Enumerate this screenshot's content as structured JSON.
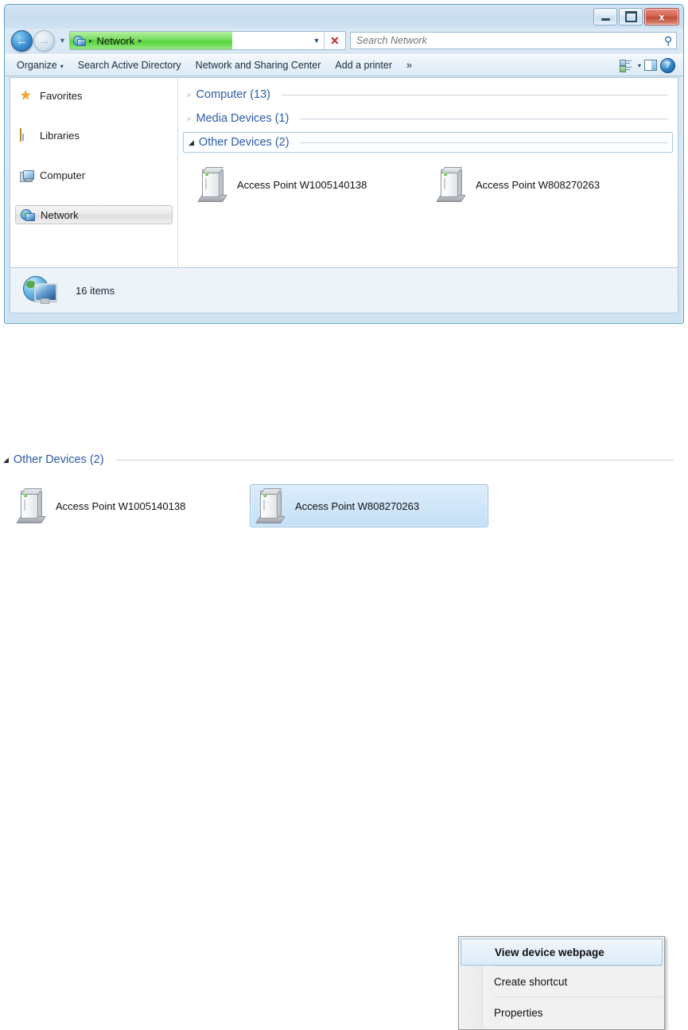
{
  "window": {
    "controls": {
      "minimize": "minimize-button",
      "maximize": "maximize-button",
      "close_label": "x"
    },
    "address": {
      "root_icon": "network-globe-icon",
      "crumb": "Network",
      "separator": "▸",
      "progress_percent": 59,
      "dropdown_glyph": "▼",
      "stop_glyph": "✕"
    },
    "search": {
      "placeholder": "Search Network",
      "value": "",
      "icon": "search-icon"
    },
    "toolbar": {
      "organize": "Organize",
      "organize_caret": "▾",
      "search_active_directory": "Search Active Directory",
      "network_sharing_center": "Network and Sharing Center",
      "add_a_printer": "Add a printer",
      "overflow": "»",
      "views_caret": "▾",
      "help_glyph": "?"
    },
    "navpane": {
      "items": [
        {
          "label": "Favorites",
          "icon": "star-icon",
          "selected": false
        },
        {
          "label": "Libraries",
          "icon": "libraries-folder-icon",
          "selected": false
        },
        {
          "label": "Computer",
          "icon": "computer-icon",
          "selected": false
        },
        {
          "label": "Network",
          "icon": "network-icon",
          "selected": true
        }
      ]
    },
    "groups": [
      {
        "label": "Computer (13)",
        "expanded": false,
        "triangle": "▹",
        "boxed": false
      },
      {
        "label": "Media Devices (1)",
        "expanded": false,
        "triangle": "▹",
        "boxed": false
      },
      {
        "label": "Other Devices (2)",
        "expanded": true,
        "triangle": "◢",
        "boxed": true
      }
    ],
    "devices": [
      {
        "name": "Access Point W1005140138",
        "icon": "access-point-icon",
        "selected": false
      },
      {
        "name": "Access Point W808270263",
        "icon": "access-point-icon",
        "selected": false
      }
    ],
    "status": {
      "icon": "network-status-icon",
      "text": "16 items"
    }
  },
  "detail": {
    "group": {
      "label": "Other Devices (2)",
      "triangle": "◢"
    },
    "devices": [
      {
        "name": "Access Point W1005140138",
        "icon": "access-point-icon",
        "selected": false
      },
      {
        "name": "Access Point W808270263",
        "icon": "access-point-icon",
        "selected": true
      }
    ],
    "context_menu": [
      {
        "label": "View device webpage",
        "bold": true,
        "highlighted": true
      },
      {
        "label": "Create shortcut",
        "bold": false,
        "highlighted": false
      },
      {
        "label": "Properties",
        "bold": false,
        "highlighted": false
      }
    ]
  },
  "colors": {
    "accent_blue": "#2b5ba8",
    "progress_green": "#57d43c",
    "close_red": "#bf4a35",
    "selection_blue": "#c5e0f7"
  }
}
